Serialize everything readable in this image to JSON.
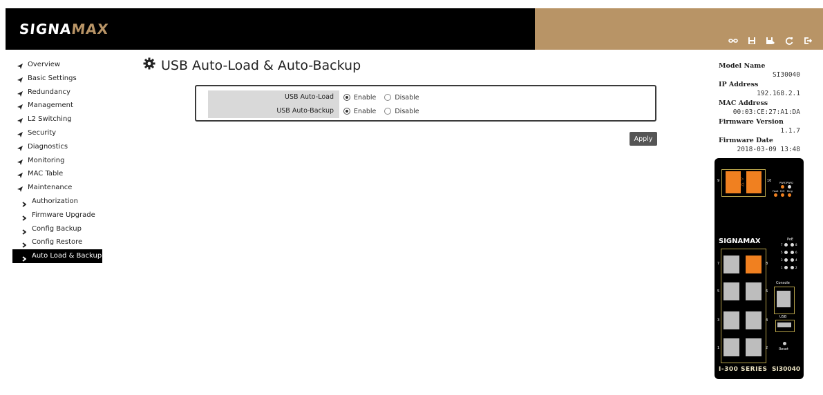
{
  "header": {
    "logo_main": "SIGNA",
    "logo_accent": "MAX",
    "icons": [
      "link-icon",
      "save-icon",
      "save-as-icon",
      "refresh-icon",
      "logout-icon"
    ]
  },
  "sidebar": {
    "items": [
      {
        "label": "Overview"
      },
      {
        "label": "Basic Settings"
      },
      {
        "label": "Redundancy"
      },
      {
        "label": "Management"
      },
      {
        "label": "L2 Switching"
      },
      {
        "label": "Security"
      },
      {
        "label": "Diagnostics"
      },
      {
        "label": "Monitoring"
      },
      {
        "label": "MAC Table"
      },
      {
        "label": "Maintenance"
      }
    ],
    "subitems": [
      {
        "label": "Authorization"
      },
      {
        "label": "Firmware Upgrade"
      },
      {
        "label": "Config Backup"
      },
      {
        "label": "Config Restore"
      },
      {
        "label": "Auto Load & Backup",
        "active": true
      }
    ]
  },
  "main": {
    "title": "USB Auto-Load & Auto-Backup",
    "rows": [
      {
        "label": "USB Auto-Load",
        "enable": "Enable",
        "disable": "Disable",
        "selected": "Enable"
      },
      {
        "label": "USB Auto-Backup",
        "enable": "Enable",
        "disable": "Disable",
        "selected": "Enable"
      }
    ],
    "apply_label": "Apply"
  },
  "device_info": {
    "model_label": "Model Name",
    "model_value": "SI30040",
    "ip_label": "IP Address",
    "ip_value": "192.168.2.1",
    "mac_label": "MAC Address",
    "mac_value": "00:03:CE:27:A1:DA",
    "fw_label": "Firmware Version",
    "fw_value": "1.1.7",
    "fw_date_label": "Firmware Date",
    "fw_date_value": "2018-03-09 13:48"
  },
  "device_panel": {
    "brand": "SIGNAMAX",
    "series": "I-300 SERIES",
    "model": "SI30040",
    "poe": "PoE",
    "console": "Console",
    "usb": "USB",
    "reset": "Reset",
    "led_labels": [
      "PWR1",
      "PWR2",
      "Fault",
      "R.M",
      "Ring"
    ],
    "port_numbers": [
      "9",
      "10",
      "7",
      "8",
      "5",
      "6",
      "3",
      "4",
      "1",
      "2"
    ],
    "poe_numbers": [
      "7",
      "8",
      "5",
      "6",
      "3",
      "4",
      "1",
      "2"
    ]
  },
  "colors": {
    "header_black": "#000000",
    "header_gold": "#b89466",
    "accent_orange": "#f08020",
    "active_nav_bg": "#000000"
  }
}
